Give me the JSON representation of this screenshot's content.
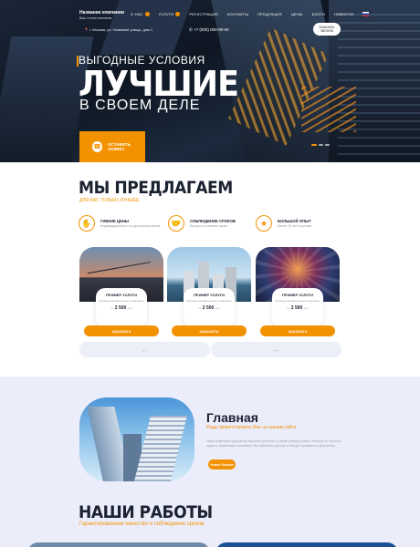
{
  "header": {
    "logo_title": "Название компании",
    "logo_sub": "Ваш слоган компании",
    "menu": [
      {
        "label": "О НАС",
        "badge": true
      },
      {
        "label": "УСЛУГИ",
        "badge": true
      },
      {
        "label": "РЕГИСТРАЦИЯ",
        "badge": false
      },
      {
        "label": "КОНТАКТЫ",
        "badge": false
      },
      {
        "label": "ПРОДУКЦИЯ",
        "badge": false
      },
      {
        "label": "ЦЕНЫ",
        "badge": false
      },
      {
        "label": "БЛОГИ",
        "badge": false
      },
      {
        "label": "НОВОСТИ",
        "badge": false
      }
    ],
    "address": "г. Москва, ул. Название улицы, дом 1",
    "phone": "+7 (000) 000-00-00",
    "callback_label": "ЗАКАЗАТЬ ЗВОНОК"
  },
  "hero": {
    "tagline": "ВЫГОДНЫЕ УСЛОВИЯ",
    "headline": "ЛУЧШИЕ",
    "subline": "В СВОЕМ ДЕЛЕ",
    "apply_label": "ОСТАВИТЬ ЗАЯВКУ"
  },
  "offer": {
    "title": "МЫ ПРЕДЛАГАЕМ",
    "subtitle": "ДЛЯ ВАС ТОЛЬКО ЛУЧШЕЕ",
    "features": [
      {
        "title": "ГИБКИЕ ЦЕНЫ",
        "desc": "Индивидуальное и по доступным ценам",
        "icon": "handshake-icon",
        "glyph": "✋"
      },
      {
        "title": "СОБЛЮДЕНИЕ СРОКОВ",
        "desc": "Быстро и в сжатые сроки",
        "icon": "handshake-deal-icon",
        "glyph": "🤝"
      },
      {
        "title": "БОЛЬШОЙ ОПЫТ",
        "desc": "Более 10 лет на рынке",
        "icon": "award-icon",
        "glyph": "★"
      }
    ],
    "cards": [
      {
        "title": "ПРИМЕР УСЛУГИ",
        "desc": "Краткое описание услуги компании",
        "price_prefix": "от",
        "price": "2 500",
        "price_unit": "руб",
        "button": "ЗАКАЗАТЬ"
      },
      {
        "title": "ПРИМЕР УСЛУГИ",
        "desc": "Краткое описание услуги компании",
        "price_prefix": "от",
        "price": "2 500",
        "price_unit": "руб",
        "button": "ЗАКАЗАТЬ"
      },
      {
        "title": "ПРИМЕР УСЛУГИ",
        "desc": "Краткое описание услуги компании",
        "price_prefix": "от",
        "price": "2 500",
        "price_unit": "руб",
        "button": "ЗАКАЗАТЬ"
      }
    ],
    "prev_arrow": "←",
    "next_arrow": "→"
  },
  "about": {
    "title": "Главная",
    "subtitle": "Рады приветствовать Вас на нашем сайте",
    "text": "Наша компания предлагает высокое качество, а также разные услуги, начиная от простых задач и заканчивая сложными. Мы работаем для вас и всегда стремимся к результату.",
    "button": "Узнать больше"
  },
  "works": {
    "title": "НАШИ РАБОТЫ",
    "subtitle": "Гарантированное качество и соблюдение сроков"
  },
  "colors": {
    "accent": "#f39200",
    "dark": "#1b2230",
    "soft_bg": "#ecedfb"
  }
}
